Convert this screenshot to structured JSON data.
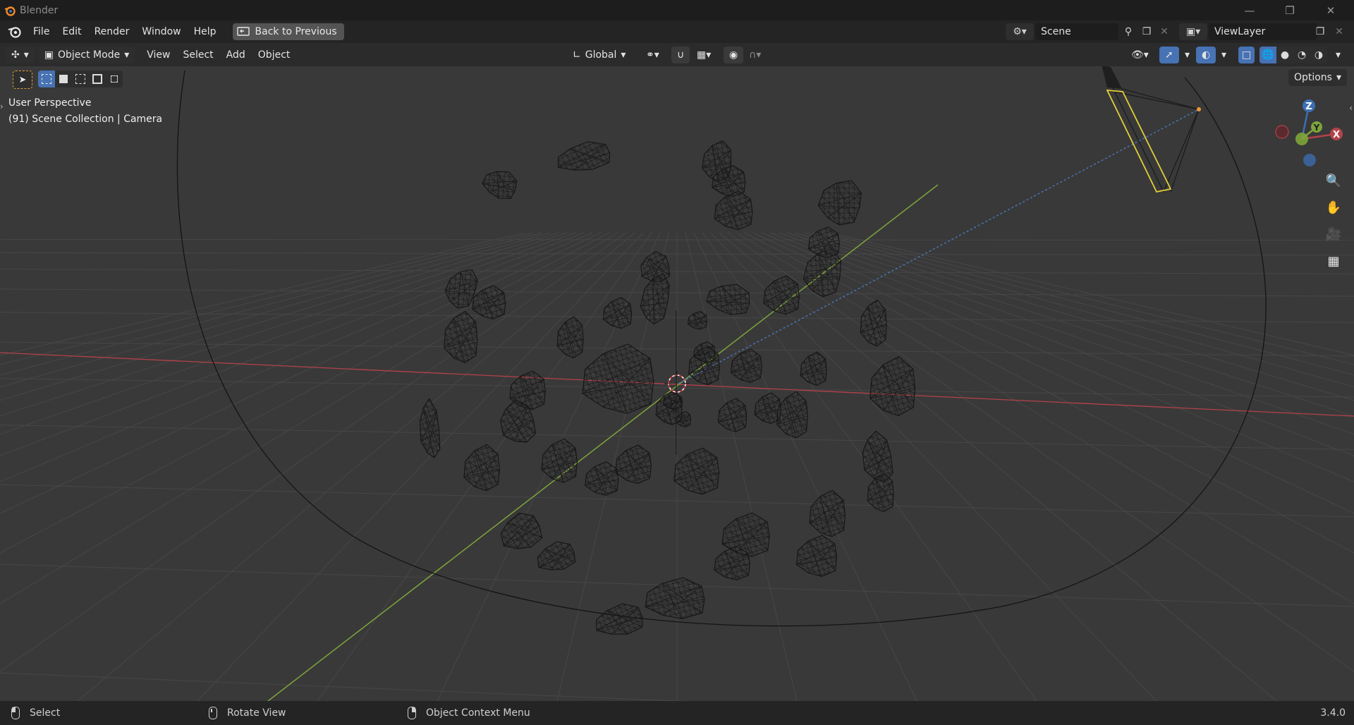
{
  "window": {
    "title": "Blender"
  },
  "menubar": {
    "items": [
      "File",
      "Edit",
      "Render",
      "Window",
      "Help"
    ],
    "back_button": "Back to Previous",
    "scene": "Scene",
    "view_layer": "ViewLayer"
  },
  "view_header": {
    "mode": "Object Mode",
    "menus": [
      "View",
      "Select",
      "Add",
      "Object"
    ],
    "transform_orientation": "Global",
    "options": "Options"
  },
  "viewport": {
    "perspective": "User Perspective",
    "collection_info": "(91) Scene Collection | Camera",
    "gizmo_axes": [
      "Z",
      "Y",
      "X"
    ]
  },
  "statusbar": {
    "select": "Select",
    "rotate_view": "Rotate View",
    "context_menu": "Object Context Menu",
    "version": "3.4.0"
  },
  "colors": {
    "x_axis": "#b4424a",
    "y_axis": "#7ea53a",
    "z_axis": "#3c6fb4",
    "accent": "#4772b3"
  }
}
